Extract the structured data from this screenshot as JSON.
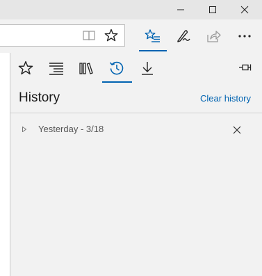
{
  "window": {
    "buttons": [
      {
        "name": "minimize",
        "icon": "minimize-icon"
      },
      {
        "name": "maximize",
        "icon": "maximize-icon"
      },
      {
        "name": "close",
        "icon": "close-icon"
      }
    ]
  },
  "toolbar": {
    "address_value": "",
    "icons": [
      "reading-view-icon",
      "favorite-star-icon",
      "hub-icon",
      "web-note-icon",
      "share-icon",
      "more-icon"
    ],
    "accent": "#0063b1"
  },
  "hub": {
    "tabs": [
      {
        "name": "favorites",
        "icon": "star-icon",
        "active": false
      },
      {
        "name": "reading-list",
        "icon": "reading-list-icon",
        "active": false
      },
      {
        "name": "books",
        "icon": "books-icon",
        "active": false
      },
      {
        "name": "history",
        "icon": "history-icon",
        "active": true
      },
      {
        "name": "downloads",
        "icon": "download-icon",
        "active": false
      }
    ],
    "pin_icon": "pin-icon",
    "title": "History",
    "clear_label": "Clear history",
    "groups": [
      {
        "label": "Yesterday - 3/18",
        "expanded": false
      }
    ]
  }
}
